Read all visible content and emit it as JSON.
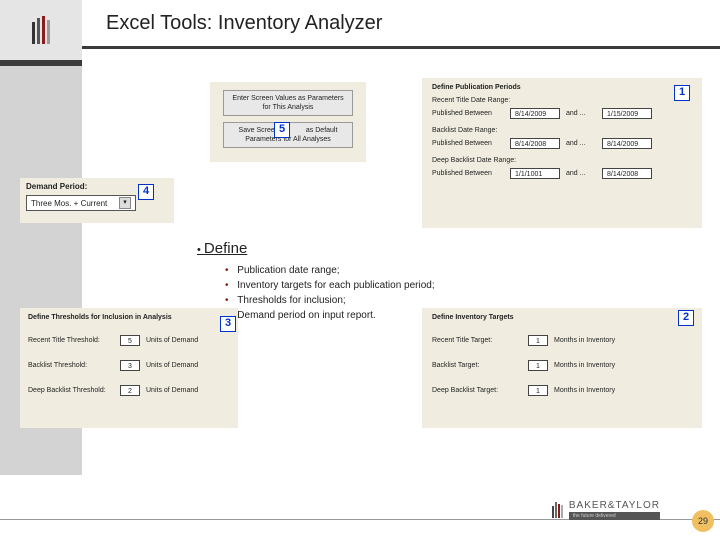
{
  "title": "Excel Tools: Inventory Analyzer",
  "heading": "Define",
  "bullets": [
    "Publication date range;",
    "Inventory targets for each publication period;",
    "Thresholds for inclusion;",
    "Demand period on input report."
  ],
  "callouts": {
    "c1": "1",
    "c2": "2",
    "c3": "3",
    "c4": "4",
    "c5": "5"
  },
  "param_buttons": {
    "enter": "Enter Screen Values as Parameters\nfor This Analysis",
    "save_pre": "Save Screen",
    "save_post": "as Default\nParameters for All Analyses"
  },
  "pub_periods": {
    "title": "Define Publication Periods",
    "recent_hdr": "Recent Title Date Range:",
    "backlist_hdr": "Backlist Date Range:",
    "deep_hdr": "Deep Backlist Date Range:",
    "pub_between": "Published Between",
    "and": "and ...",
    "recent_from": "8/14/2009",
    "recent_to": "1/15/2009",
    "backlist_from": "8/14/2008",
    "backlist_to": "8/14/2009",
    "deep_from": "1/1/1001",
    "deep_to": "8/14/2008"
  },
  "demand": {
    "label": "Demand Period:",
    "value": "Three Mos. + Current"
  },
  "thresholds": {
    "title": "Define Thresholds for Inclusion in Analysis",
    "recent_lbl": "Recent Title Threshold:",
    "backlist_lbl": "Backlist Threshold:",
    "deep_lbl": "Deep Backlist Threshold:",
    "unit": "Units of Demand",
    "recent_val": "5",
    "backlist_val": "3",
    "deep_val": "2"
  },
  "targets": {
    "title": "Define Inventory Targets",
    "recent_lbl": "Recent Title Target:",
    "backlist_lbl": "Backlist Target:",
    "deep_lbl": "Deep Backlist Target:",
    "unit": "Months in Inventory",
    "recent_val": "1",
    "backlist_val": "1",
    "deep_val": "1"
  },
  "brand": {
    "name": "BAKER&TAYLOR",
    "tagline": "the future delivered"
  },
  "page": "29"
}
